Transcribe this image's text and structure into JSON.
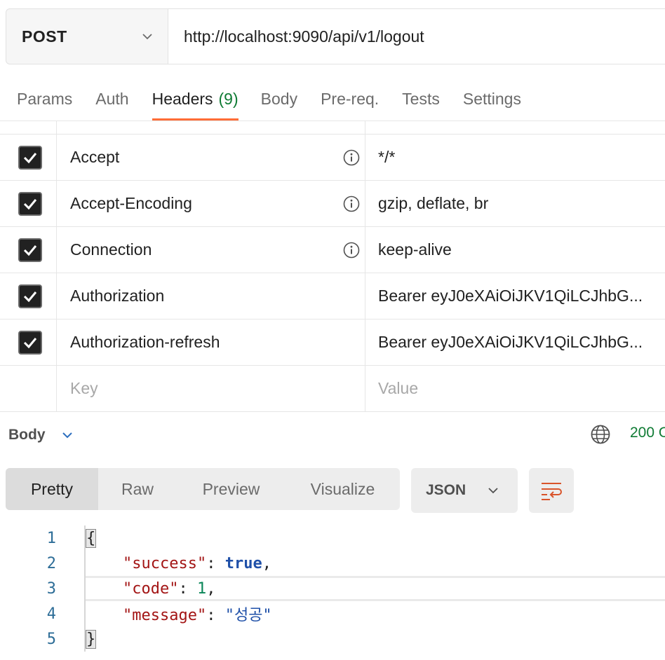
{
  "request": {
    "method": "POST",
    "url": "http://localhost:9090/api/v1/logout"
  },
  "tabs": {
    "params": "Params",
    "auth": "Auth",
    "headers": "Headers",
    "headers_count": "(9)",
    "body": "Body",
    "prereq": "Pre-req.",
    "tests": "Tests",
    "settings": "Settings"
  },
  "headers_table": {
    "rows": [
      {
        "key": "Accept",
        "value": "*/*",
        "checked": true
      },
      {
        "key": "Accept-Encoding",
        "value": "gzip, deflate, br",
        "checked": true
      },
      {
        "key": "Connection",
        "value": "keep-alive",
        "checked": true
      },
      {
        "key": "Authorization",
        "value": "Bearer eyJ0eXAiOiJKV1QiLCJhbG...",
        "checked": true
      },
      {
        "key": "Authorization-refresh",
        "value": "Bearer eyJ0eXAiOiJKV1QiLCJhbG...",
        "checked": true
      }
    ],
    "key_placeholder": "Key",
    "value_placeholder": "Value"
  },
  "response": {
    "title": "Body",
    "status": "200 O",
    "formats": [
      "Pretty",
      "Raw",
      "Preview",
      "Visualize"
    ],
    "selected_format": "Pretty",
    "language": "JSON"
  },
  "code": {
    "line_numbers": [
      "1",
      "2",
      "3",
      "4",
      "5"
    ],
    "open_brace": "{",
    "close_brace": "}",
    "k1": "\"success\"",
    "v1": "true",
    "k2": "\"code\"",
    "v2": "1",
    "k3": "\"message\"",
    "v3": "\"성공\""
  },
  "colors": {
    "accent": "#ff6c37",
    "status_ok": "#0f7b34",
    "json_key": "#a31515",
    "json_value": "#1f50a8"
  }
}
